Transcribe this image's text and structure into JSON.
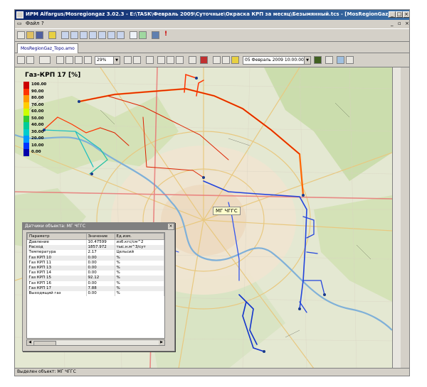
{
  "window": {
    "title": "ИРМ Alfargus/Mosregiongaz 3.02.3 - E:\\TASK\\Февраль 2009\\Суточные\\Окраска КРП за месяц\\Безымянный.tcs - [MosRegionGaz_Topo.amo]"
  },
  "menu": {
    "file": "Файл",
    "help": "?"
  },
  "tab": {
    "label": "MosRegionGaz_Topo.amo"
  },
  "toolbar2": {
    "zoom_value": "29%",
    "datetime_value": "05 Февраль 2009 10:00:00"
  },
  "legend": {
    "title": "Газ-КРП 17 [%]",
    "items": [
      {
        "label": "100.00",
        "color": "#cc0000"
      },
      {
        "label": "90.00",
        "color": "#ff3300"
      },
      {
        "label": "80.00",
        "color": "#ff9900"
      },
      {
        "label": "70.00",
        "color": "#ffcc00"
      },
      {
        "label": "60.00",
        "color": "#ccff00"
      },
      {
        "label": "50.00",
        "color": "#33cc33"
      },
      {
        "label": "40.00",
        "color": "#00cc99"
      },
      {
        "label": "30.00",
        "color": "#00cccc"
      },
      {
        "label": "20.00",
        "color": "#0099ff"
      },
      {
        "label": "10.00",
        "color": "#0033ff"
      },
      {
        "label": "0.00",
        "color": "#0000aa"
      }
    ]
  },
  "map": {
    "label": "МГ ЧГГС"
  },
  "panel": {
    "title": "Датчики объекта: МГ ЧГГС",
    "columns": [
      "Параметр",
      "Значение",
      "Ед.изм."
    ],
    "rows": [
      [
        "Давление",
        "10.47599",
        "изб.кгс/см^2"
      ],
      [
        "Расход",
        "1857.972",
        "тыс.н.м^3/сут"
      ],
      [
        "Температура",
        "2.17",
        "Цельсий"
      ],
      [
        "Газ КРП 10",
        "0.00",
        "%"
      ],
      [
        "Газ КРП 11",
        "0.00",
        "%"
      ],
      [
        "Газ КРП 13",
        "0.00",
        "%"
      ],
      [
        "Газ КРП 14",
        "0.00",
        "%"
      ],
      [
        "Газ КРП 15",
        "92.12",
        "%"
      ],
      [
        "Газ КРП 16",
        "0.00",
        "%"
      ],
      [
        "Газ КРП 17",
        "7.88",
        "%"
      ],
      [
        "Выходящий газ",
        "0.00",
        "%"
      ]
    ]
  },
  "status": {
    "text": "Выделен объект: МГ ЧГГС"
  }
}
